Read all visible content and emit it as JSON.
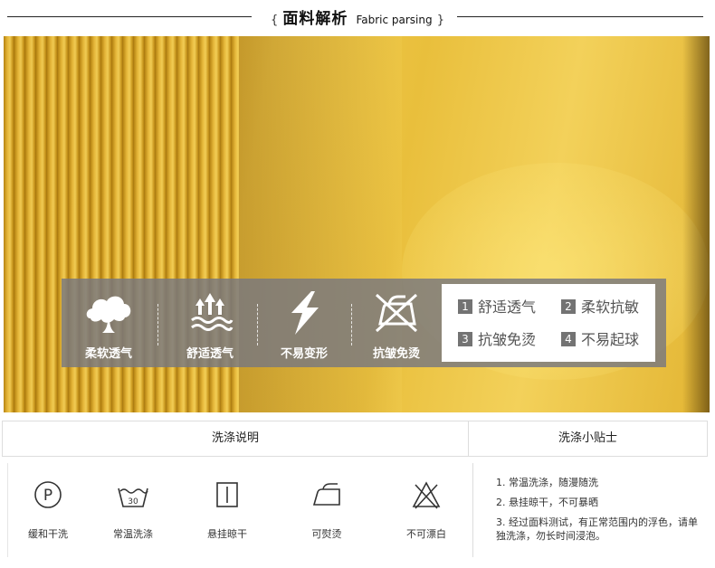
{
  "header": {
    "brace_open": "{",
    "title_cn": "面料解析",
    "title_en": "Fabric parsing",
    "brace_close": "}"
  },
  "features": [
    {
      "label": "柔软透气",
      "icon": "cloud-icon"
    },
    {
      "label": "舒适透气",
      "icon": "breathable-arrows-icon"
    },
    {
      "label": "不易变形",
      "icon": "lightning-icon"
    },
    {
      "label": "抗皱免烫",
      "icon": "no-iron-icon"
    }
  ],
  "feature_box": [
    {
      "num": "1",
      "text": "舒适透气"
    },
    {
      "num": "2",
      "text": "柔软抗敏"
    },
    {
      "num": "3",
      "text": "抗皱免烫"
    },
    {
      "num": "4",
      "text": "不易起球"
    }
  ],
  "care": {
    "left_title": "洗涤说明",
    "right_title": "洗涤小贴士",
    "symbols": [
      {
        "label": "缓和干洗",
        "icon": "dry-clean-p-icon"
      },
      {
        "label": "常温洗涤",
        "icon": "wash-30-icon"
      },
      {
        "label": "悬挂晾干",
        "icon": "hang-dry-icon"
      },
      {
        "label": "可熨烫",
        "icon": "iron-icon"
      },
      {
        "label": "不可漂白",
        "icon": "no-bleach-icon"
      }
    ],
    "tips": [
      "1. 常温洗涤，随漫随洗",
      "2. 悬挂晾干，不可暴晒",
      "3. 经过面料测试，有正常范围内的浮色，请单独洗涤，勿长时间浸泡。"
    ]
  },
  "colors": {
    "fabric_yellow": "#e9bf3c",
    "band_gray": "#78787f",
    "badge_gray": "#737373"
  }
}
